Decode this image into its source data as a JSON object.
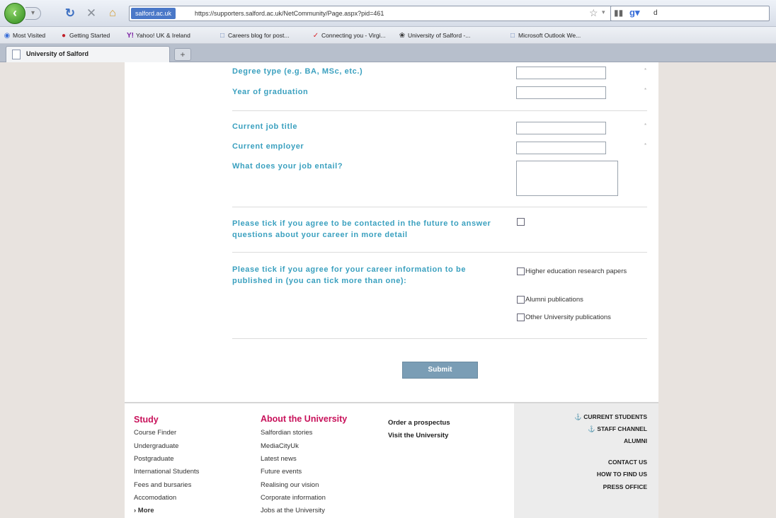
{
  "browser": {
    "url_identity": "salford.ac.uk",
    "url": "https://supporters.salford.ac.uk/NetCommunity/Page.aspx?pid=461",
    "search_value": "d",
    "bookmarks": [
      {
        "label": "Most Visited",
        "icon": "firefox-icon"
      },
      {
        "label": "Getting Started",
        "icon": "getting-started-icon"
      },
      {
        "label": "Yahoo! UK & Ireland",
        "icon": "yahoo-icon"
      },
      {
        "label": "Careers blog for post...",
        "icon": "page-icon"
      },
      {
        "label": "Connecting you - Virgi...",
        "icon": "virgin-icon"
      },
      {
        "label": "University of Salford -...",
        "icon": "salford-icon"
      },
      {
        "label": "Microsoft Outlook We...",
        "icon": "page-icon"
      }
    ],
    "tab_title": "University of Salford",
    "new_tab_symbol": "+"
  },
  "form": {
    "fields": [
      {
        "label": "Degree type (e.g. BA, MSc, etc.)"
      },
      {
        "label": "Year of graduation"
      },
      {
        "label": "Current job title"
      },
      {
        "label": "Current employer"
      }
    ],
    "job_entail_label": "What does your job entail?",
    "contact_label": "Please tick if you agree to be contacted in the future to answer questions about your career in more detail",
    "publish_label": "Please tick if you agree for your career information to be published in (you can tick more than one):",
    "publish_options": [
      "Higher education research papers",
      "Alumni publications",
      "Other University publications"
    ],
    "required_mark": "*",
    "submit_label": "Submit"
  },
  "footer": {
    "study": {
      "heading": "Study",
      "links": [
        "Course Finder",
        "Undergraduate",
        "Postgraduate",
        "International Students",
        "Fees and bursaries",
        "Accomodation",
        "› More"
      ]
    },
    "about": {
      "heading": "About the University",
      "links": [
        "Salfordian stories",
        "MediaCityUk",
        "Latest news",
        "Future events",
        "Realising our vision",
        "Corporate information",
        "Jobs at the University"
      ]
    },
    "extra_links": [
      "Order a prospectus",
      "Visit the University"
    ],
    "quick_links": [
      "⚓ CURRENT STUDENTS",
      "⚓ STAFF CHANNEL",
      "ALUMNI"
    ],
    "contact_links": [
      "CONTACT US",
      "HOW TO FIND US",
      "PRESS OFFICE"
    ]
  }
}
